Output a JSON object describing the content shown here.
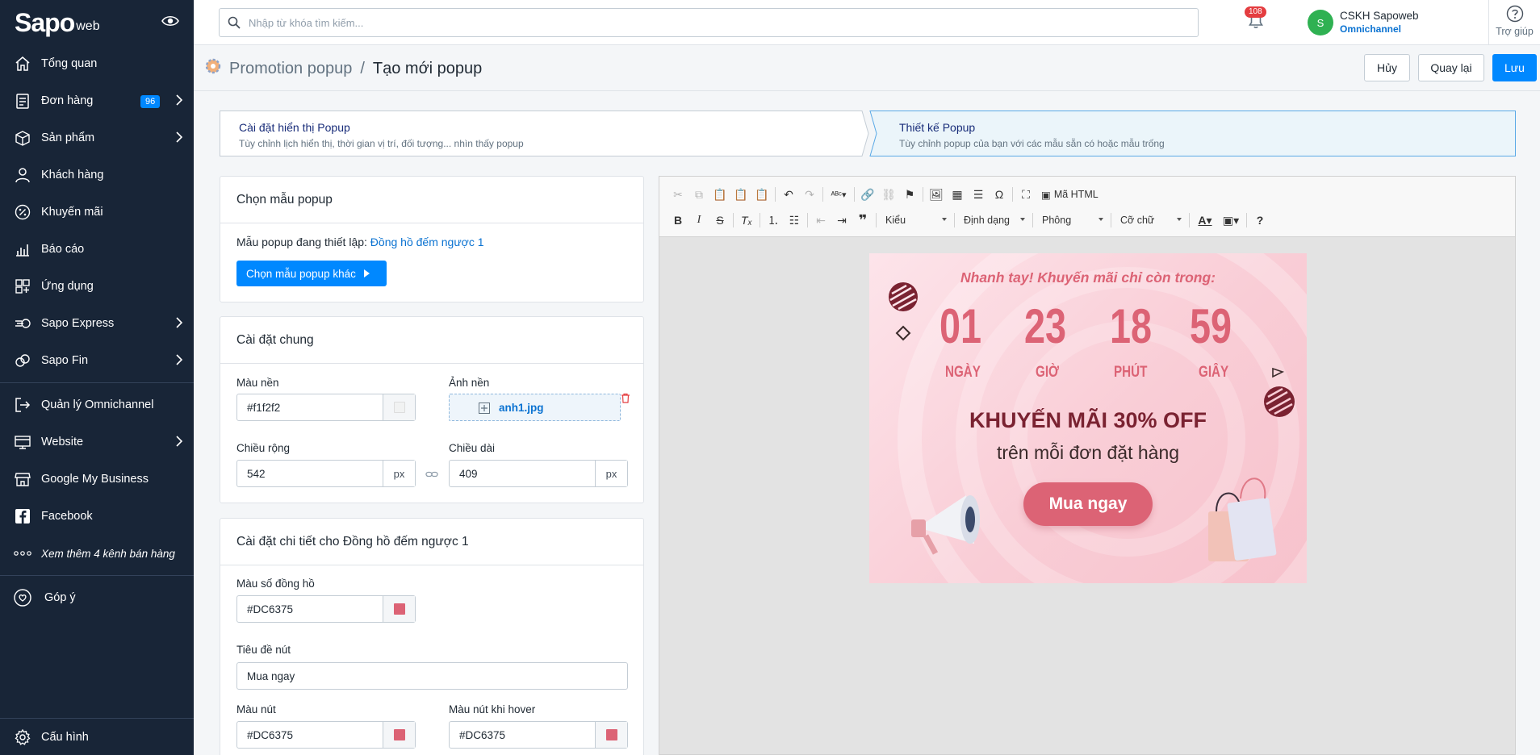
{
  "brand": {
    "name": "Sapo",
    "sub": "web"
  },
  "sidebar": {
    "items": [
      {
        "label": "Tổng quan",
        "icon": "home-icon"
      },
      {
        "label": "Đơn hàng",
        "icon": "orders-icon",
        "badge": "96",
        "has_children": true
      },
      {
        "label": "Sản phẩm",
        "icon": "box-icon",
        "has_children": true
      },
      {
        "label": "Khách hàng",
        "icon": "user-icon"
      },
      {
        "label": "Khuyến mãi",
        "icon": "percent-icon"
      },
      {
        "label": "Báo cáo",
        "icon": "chart-icon"
      },
      {
        "label": "Ứng dụng",
        "icon": "apps-icon"
      },
      {
        "label": "Sapo Express",
        "icon": "express-icon",
        "has_children": true
      },
      {
        "label": "Sapo Fin",
        "icon": "fin-icon",
        "has_children": true
      }
    ],
    "channels": [
      {
        "label": "Quản lý Omnichannel",
        "icon": "omnichannel-icon"
      },
      {
        "label": "Website",
        "icon": "website-icon",
        "has_children": true
      },
      {
        "label": "Google My Business",
        "icon": "store-icon"
      },
      {
        "label": "Facebook",
        "icon": "facebook-icon"
      },
      {
        "label": "Xem thêm 4 kênh bán hàng",
        "icon": "more-icon"
      }
    ],
    "feedback": "Góp ý",
    "settings": "Cấu hình"
  },
  "topbar": {
    "search_placeholder": "Nhập từ khóa tìm kiếm...",
    "notifications": "108",
    "user_initial": "S",
    "user_name": "CSKH Sapoweb",
    "user_org": "Omnichannel",
    "help": "Trợ giúp"
  },
  "page": {
    "breadcrumb_parent": "Promotion popup",
    "breadcrumb_sep": "/",
    "title": "Tạo mới popup",
    "cancel": "Hủy",
    "back": "Quay lại",
    "save": "Lưu"
  },
  "steps": [
    {
      "title": "Cài đặt hiển thị Popup",
      "desc": "Tùy chỉnh lịch hiển thị, thời gian vị trí, đối tượng... nhìn thấy popup"
    },
    {
      "title": "Thiết kế Popup",
      "desc": "Tùy chỉnh popup của bạn với các mẫu sẵn có hoặc mẫu trống"
    }
  ],
  "template_card": {
    "title": "Chọn mẫu popup",
    "current_label": "Mẫu popup đang thiết lập:",
    "current_value": "Đồng hồ đếm ngược 1",
    "choose_button": "Chọn mẫu popup khác"
  },
  "general_card": {
    "title": "Cài đặt chung",
    "bg_color_label": "Màu nền",
    "bg_color_value": "#f1f2f2",
    "bg_image_label": "Ảnh nền",
    "bg_image_file": "anh1.jpg",
    "width_label": "Chiều rộng",
    "width_value": "542",
    "height_label": "Chiều dài",
    "height_value": "409",
    "unit": "px"
  },
  "detail_card": {
    "title": "Cài đặt chi tiết cho Đồng hồ đếm ngược 1",
    "clock_color_label": "Màu số đồng hồ",
    "clock_color_value": "#DC6375",
    "button_title_label": "Tiêu đề nút",
    "button_title_value": "Mua ngay",
    "button_color_label": "Màu nút",
    "button_color_value": "#DC6375",
    "button_hover_label": "Màu nút khi hover",
    "button_hover_value": "#DC6375"
  },
  "editor": {
    "html_button": "Mã HTML",
    "style_combo": "Kiểu",
    "format_combo": "Định dạng",
    "font_combo": "Phông",
    "size_combo": "Cỡ chữ"
  },
  "popup": {
    "headline": "Nhanh tay! Khuyến mãi chỉ còn trong:",
    "countdown": [
      {
        "value": "01",
        "unit": "NGÀY"
      },
      {
        "value": "23",
        "unit": "GIỜ"
      },
      {
        "value": "18",
        "unit": "PHÚT"
      },
      {
        "value": "59",
        "unit": "GIÂY"
      }
    ],
    "offer": "KHUYẾN MÃI 30% OFF",
    "offer_sub": "trên mỗi đơn đặt hàng",
    "cta": "Mua ngay"
  },
  "colors": {
    "accent": "#0088ff",
    "sidebar": "#182537",
    "clock": "#DC6375",
    "swatch_bg": "#f1f2f2"
  }
}
